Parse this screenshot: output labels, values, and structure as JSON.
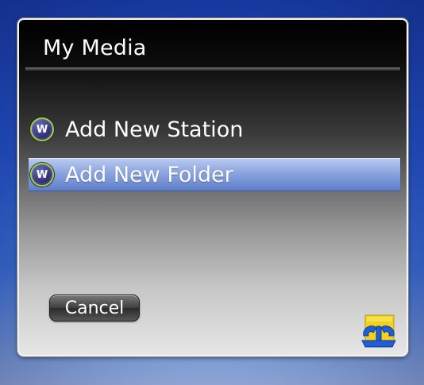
{
  "dialog": {
    "title": "My Media",
    "items": [
      {
        "label": "Add New Station",
        "icon": "station-globe-icon",
        "selected": false
      },
      {
        "label": "Add New Folder",
        "icon": "station-globe-icon",
        "selected": true
      }
    ],
    "icon_glyph": "W",
    "cancel_label": "Cancel",
    "tools_icon": "tools-wrench-icon"
  },
  "colors": {
    "background": "#2352c4",
    "selection": "#8ba4df",
    "icon_ring": "#98d24a",
    "tools_yellow": "#f2d21f",
    "tools_blue": "#1f5fd6"
  }
}
